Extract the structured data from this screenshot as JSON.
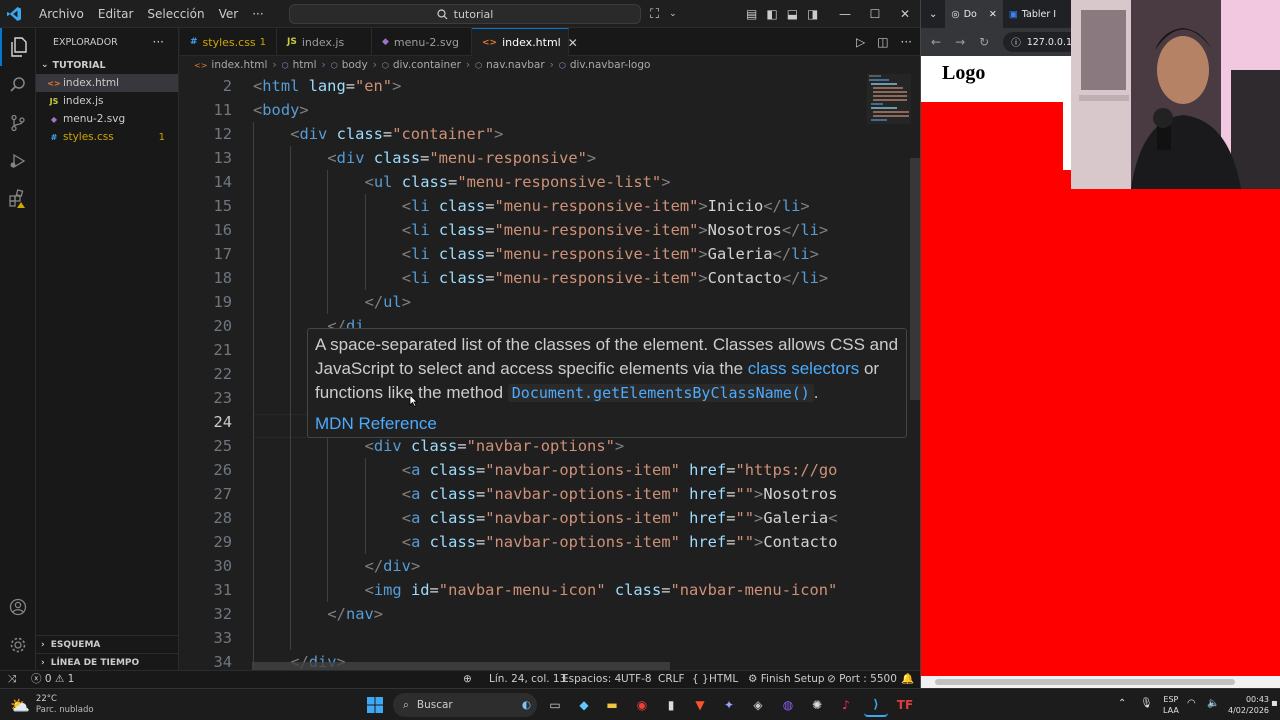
{
  "titlebar": {
    "menu": [
      "Archivo",
      "Editar",
      "Selección",
      "Ver"
    ],
    "more": "···",
    "search": "tutorial"
  },
  "sidebar": {
    "title": "EXPLORADOR",
    "folder": "TUTORIAL",
    "files": [
      {
        "name": "index.html",
        "icon": "<>",
        "color": "#e37933"
      },
      {
        "name": "index.js",
        "icon": "JS",
        "color": "#cbcb41"
      },
      {
        "name": "menu-2.svg",
        "icon": "◆",
        "color": "#a074c4"
      },
      {
        "name": "styles.css",
        "icon": "#",
        "color": "#42a5f5",
        "problems": "1"
      }
    ],
    "sections": [
      "ESQUEMA",
      "LÍNEA DE TIEMPO"
    ]
  },
  "tabs": [
    {
      "label": "styles.css",
      "icon": "#",
      "color": "#42a5f5",
      "badge": "1"
    },
    {
      "label": "index.js",
      "icon": "JS",
      "color": "#cbcb41"
    },
    {
      "label": "menu-2.svg",
      "icon": "◆",
      "color": "#a074c4"
    },
    {
      "label": "index.html",
      "icon": "<>",
      "color": "#e37933",
      "close": "✕"
    }
  ],
  "breadcrumb": [
    "index.html",
    "html",
    "body",
    "div.container",
    "nav.navbar",
    "div.navbar-logo"
  ],
  "editor": {
    "lines": [
      {
        "n": "2",
        "indent": 0,
        "tokens": [
          [
            "tg",
            "<"
          ],
          [
            "tn",
            "html"
          ],
          [
            "tx",
            " "
          ],
          [
            "at",
            "lang"
          ],
          [
            "tx",
            "="
          ],
          [
            "st",
            "\"en\""
          ],
          [
            "tg",
            ">"
          ]
        ]
      },
      {
        "n": "11",
        "indent": 0,
        "tokens": [
          [
            "tg",
            "<"
          ],
          [
            "tn",
            "body"
          ],
          [
            "tg",
            ">"
          ]
        ]
      },
      {
        "n": "12",
        "indent": 1,
        "tokens": [
          [
            "tg",
            "<"
          ],
          [
            "tn",
            "div"
          ],
          [
            "tx",
            " "
          ],
          [
            "at",
            "class"
          ],
          [
            "tx",
            "="
          ],
          [
            "st",
            "\"container\""
          ],
          [
            "tg",
            ">"
          ]
        ]
      },
      {
        "n": "13",
        "indent": 2,
        "tokens": [
          [
            "tg",
            "<"
          ],
          [
            "tn",
            "div"
          ],
          [
            "tx",
            " "
          ],
          [
            "at",
            "class"
          ],
          [
            "tx",
            "="
          ],
          [
            "st",
            "\"menu-responsive\""
          ],
          [
            "tg",
            ">"
          ]
        ]
      },
      {
        "n": "14",
        "indent": 3,
        "tokens": [
          [
            "tg",
            "<"
          ],
          [
            "tn",
            "ul"
          ],
          [
            "tx",
            " "
          ],
          [
            "at",
            "class"
          ],
          [
            "tx",
            "="
          ],
          [
            "st",
            "\"menu-responsive-list\""
          ],
          [
            "tg",
            ">"
          ]
        ]
      },
      {
        "n": "15",
        "indent": 4,
        "tokens": [
          [
            "tg",
            "<"
          ],
          [
            "tn",
            "li"
          ],
          [
            "tx",
            " "
          ],
          [
            "at",
            "class"
          ],
          [
            "tx",
            "="
          ],
          [
            "st",
            "\"menu-responsive-item\""
          ],
          [
            "tg",
            ">"
          ],
          [
            "tx",
            "Inicio"
          ],
          [
            "tg",
            "</"
          ],
          [
            "tn",
            "li"
          ],
          [
            "tg",
            ">"
          ]
        ]
      },
      {
        "n": "16",
        "indent": 4,
        "tokens": [
          [
            "tg",
            "<"
          ],
          [
            "tn",
            "li"
          ],
          [
            "tx",
            " "
          ],
          [
            "at",
            "class"
          ],
          [
            "tx",
            "="
          ],
          [
            "st",
            "\"menu-responsive-item\""
          ],
          [
            "tg",
            ">"
          ],
          [
            "tx",
            "Nosotros"
          ],
          [
            "tg",
            "</"
          ],
          [
            "tn",
            "li"
          ],
          [
            "tg",
            ">"
          ]
        ]
      },
      {
        "n": "17",
        "indent": 4,
        "tokens": [
          [
            "tg",
            "<"
          ],
          [
            "tn",
            "li"
          ],
          [
            "tx",
            " "
          ],
          [
            "at",
            "class"
          ],
          [
            "tx",
            "="
          ],
          [
            "st",
            "\"menu-responsive-item\""
          ],
          [
            "tg",
            ">"
          ],
          [
            "tx",
            "Galeria"
          ],
          [
            "tg",
            "</"
          ],
          [
            "tn",
            "li"
          ],
          [
            "tg",
            ">"
          ]
        ]
      },
      {
        "n": "18",
        "indent": 4,
        "tokens": [
          [
            "tg",
            "<"
          ],
          [
            "tn",
            "li"
          ],
          [
            "tx",
            " "
          ],
          [
            "at",
            "class"
          ],
          [
            "tx",
            "="
          ],
          [
            "st",
            "\"menu-responsive-item\""
          ],
          [
            "tg",
            ">"
          ],
          [
            "tx",
            "Contacto"
          ],
          [
            "tg",
            "</"
          ],
          [
            "tn",
            "li"
          ],
          [
            "tg",
            ">"
          ]
        ]
      },
      {
        "n": "19",
        "indent": 3,
        "tokens": [
          [
            "tg",
            "</"
          ],
          [
            "tn",
            "ul"
          ],
          [
            "tg",
            ">"
          ]
        ]
      },
      {
        "n": "20",
        "indent": 2,
        "tokens": [
          [
            "tg",
            "</"
          ],
          [
            "tn",
            "di"
          ]
        ]
      },
      {
        "n": "21",
        "indent": 0,
        "tokens": []
      },
      {
        "n": "22",
        "indent": 0,
        "tokens": []
      },
      {
        "n": "23",
        "indent": 0,
        "tokens": []
      },
      {
        "n": "24",
        "indent": 0,
        "tokens": [],
        "current": true
      },
      {
        "n": "25",
        "indent": 3,
        "tokens": [
          [
            "tg",
            "<"
          ],
          [
            "tn",
            "div"
          ],
          [
            "tx",
            " "
          ],
          [
            "at",
            "class"
          ],
          [
            "tx",
            "="
          ],
          [
            "st",
            "\"navbar-options\""
          ],
          [
            "tg",
            ">"
          ]
        ]
      },
      {
        "n": "26",
        "indent": 4,
        "tokens": [
          [
            "tg",
            "<"
          ],
          [
            "tn",
            "a"
          ],
          [
            "tx",
            " "
          ],
          [
            "at",
            "class"
          ],
          [
            "tx",
            "="
          ],
          [
            "st",
            "\"navbar-options-item\""
          ],
          [
            "tx",
            " "
          ],
          [
            "at",
            "href"
          ],
          [
            "tx",
            "="
          ],
          [
            "st",
            "\"https://go"
          ]
        ]
      },
      {
        "n": "27",
        "indent": 4,
        "tokens": [
          [
            "tg",
            "<"
          ],
          [
            "tn",
            "a"
          ],
          [
            "tx",
            " "
          ],
          [
            "at",
            "class"
          ],
          [
            "tx",
            "="
          ],
          [
            "st",
            "\"navbar-options-item\""
          ],
          [
            "tx",
            " "
          ],
          [
            "at",
            "href"
          ],
          [
            "tx",
            "="
          ],
          [
            "st",
            "\"\""
          ],
          [
            "tg",
            ">"
          ],
          [
            "tx",
            "Nosotros"
          ]
        ]
      },
      {
        "n": "28",
        "indent": 4,
        "tokens": [
          [
            "tg",
            "<"
          ],
          [
            "tn",
            "a"
          ],
          [
            "tx",
            " "
          ],
          [
            "at",
            "class"
          ],
          [
            "tx",
            "="
          ],
          [
            "st",
            "\"navbar-options-item\""
          ],
          [
            "tx",
            " "
          ],
          [
            "at",
            "href"
          ],
          [
            "tx",
            "="
          ],
          [
            "st",
            "\"\""
          ],
          [
            "tg",
            ">"
          ],
          [
            "tx",
            "Galeria"
          ],
          [
            "tg",
            "<"
          ]
        ]
      },
      {
        "n": "29",
        "indent": 4,
        "tokens": [
          [
            "tg",
            "<"
          ],
          [
            "tn",
            "a"
          ],
          [
            "tx",
            " "
          ],
          [
            "at",
            "class"
          ],
          [
            "tx",
            "="
          ],
          [
            "st",
            "\"navbar-options-item\""
          ],
          [
            "tx",
            " "
          ],
          [
            "at",
            "href"
          ],
          [
            "tx",
            "="
          ],
          [
            "st",
            "\"\""
          ],
          [
            "tg",
            ">"
          ],
          [
            "tx",
            "Contacto"
          ]
        ]
      },
      {
        "n": "30",
        "indent": 3,
        "tokens": [
          [
            "tg",
            "</"
          ],
          [
            "tn",
            "div"
          ],
          [
            "tg",
            ">"
          ]
        ]
      },
      {
        "n": "31",
        "indent": 3,
        "tokens": [
          [
            "tg",
            "<"
          ],
          [
            "tn",
            "img"
          ],
          [
            "tx",
            " "
          ],
          [
            "at",
            "id"
          ],
          [
            "tx",
            "="
          ],
          [
            "st",
            "\"navbar-menu-icon\""
          ],
          [
            "tx",
            " "
          ],
          [
            "at",
            "class"
          ],
          [
            "tx",
            "="
          ],
          [
            "st",
            "\"navbar-menu-icon\""
          ]
        ]
      },
      {
        "n": "32",
        "indent": 2,
        "tokens": [
          [
            "tg",
            "</"
          ],
          [
            "tn",
            "nav"
          ],
          [
            "tg",
            ">"
          ]
        ]
      },
      {
        "n": "33",
        "indent": 0,
        "tokens": []
      },
      {
        "n": "34",
        "indent": 1,
        "tokens": [
          [
            "tg",
            "</"
          ],
          [
            "tn",
            "div"
          ],
          [
            "tg",
            ">"
          ]
        ]
      }
    ]
  },
  "hover": {
    "text1": "A space-separated list of the classes of the element. Classes allows CSS and JavaScript to select and access specific elements via the ",
    "link": "class selectors",
    "text2": " or functions like the method ",
    "code": "Document.getElementsByClassName()",
    "text3": ".",
    "reference": "MDN Reference"
  },
  "statusbar": {
    "errors": "0",
    "warnings": "1",
    "position": "Lín. 24, col. 13",
    "spaces": "Espacios: 4",
    "encoding": "UTF-8",
    "eol": "CRLF",
    "braces": "{ }",
    "language": "HTML",
    "finish": "Finish Setup",
    "port": "Port : 5500"
  },
  "browser": {
    "tab1": "Do",
    "tab2": "Tabler I",
    "url": "127.0.0.1:5",
    "logo": "Logo",
    "page_color": "#ff0000"
  },
  "taskbar": {
    "weather_temp": "22°C",
    "weather_desc": "Parc. nublado",
    "search": "Buscar",
    "lang1": "ESP",
    "lang2": "LAA",
    "time": "00:43",
    "date": "4/02/2026"
  },
  "colors": {
    "accent": "#0078d4",
    "warning": "#cca700"
  }
}
